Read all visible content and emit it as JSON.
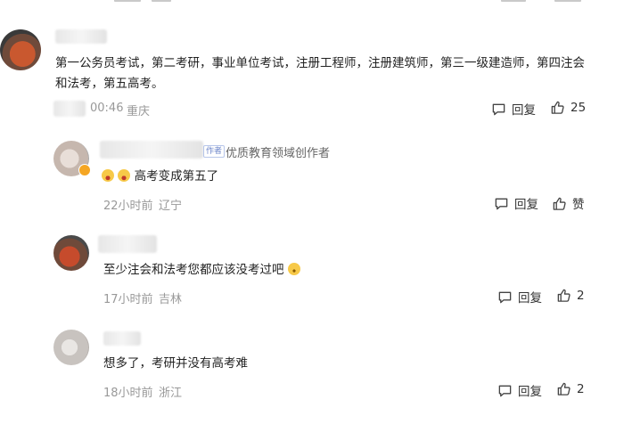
{
  "comments": [
    {
      "text": "第一公务员考试，第二考研，事业单位考试，注册工程师，注册建筑师，第三一级建造师，第四注会和法考，第五高考。",
      "time": "00:46",
      "location": "重庆",
      "reply_label": "回复",
      "like_count": "25"
    },
    {
      "author_badge": "作者",
      "author_title": "优质教育领域创作者",
      "text": "高考变成第五了",
      "time": "22小时前",
      "location": "辽宁",
      "reply_label": "回复",
      "like_label": "赞"
    },
    {
      "text": "至少注会和法考您都应该没考过吧",
      "time": "17小时前",
      "location": "吉林",
      "reply_label": "回复",
      "like_count": "2"
    },
    {
      "text": "想多了，考研并没有高考难",
      "time": "18小时前",
      "location": "浙江",
      "reply_label": "回复",
      "like_count": "2"
    }
  ],
  "icons": {
    "reply": "comment-bubble-icon",
    "like": "thumbs-up-icon",
    "verified": "verified-badge-icon",
    "emoji": "smiley-icon"
  },
  "colors": {
    "meta_gray": "#999999",
    "verified_orange": "#f5a623",
    "badge_blue": "#6b84c9"
  }
}
